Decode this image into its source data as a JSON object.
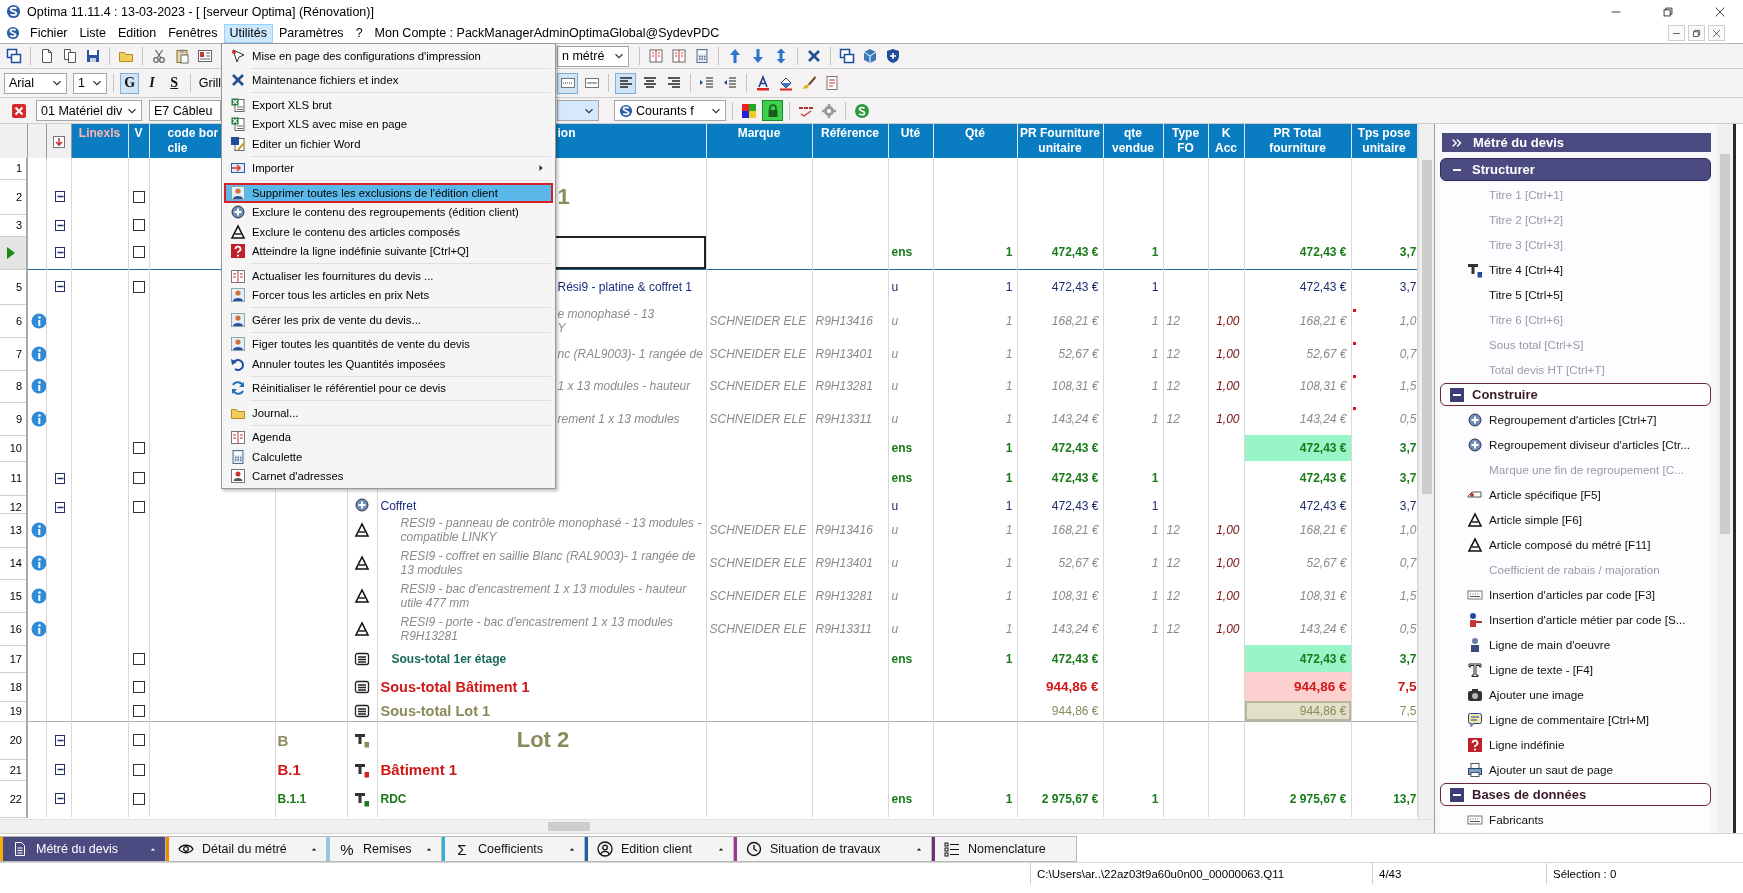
{
  "window": {
    "title": "Optima 11.11.4 : 13-03-2023 - [ [serveur Optima] (Rénovation)]"
  },
  "menu_bar": {
    "items": [
      {
        "label": "Fichier",
        "selected": false
      },
      {
        "label": "Liste",
        "selected": false
      },
      {
        "label": "Edition",
        "selected": false
      },
      {
        "label": "Fenêtres",
        "selected": false
      },
      {
        "label": "Utilités",
        "selected": true
      },
      {
        "label": "Paramètres",
        "selected": false
      },
      {
        "label": "?",
        "selected": false
      }
    ],
    "account": "Mon Compte : PackManagerAdminOptimaGlobal@SydevPDC"
  },
  "toolbar": {
    "view_dropdown": "n métré",
    "font_dropdown": "Arial",
    "size_dropdown": "1",
    "format_buttons": [
      {
        "label": "G",
        "kind": "bold",
        "selected": true
      },
      {
        "label": "I",
        "kind": "italic",
        "selected": false
      },
      {
        "label": "S",
        "kind": "underline",
        "selected": false
      }
    ],
    "grid_label": "Grill",
    "paragraph_buttons": [
      {
        "kind": "border-dotted",
        "selected": true
      },
      {
        "kind": "border-solid",
        "selected": false
      },
      {
        "kind": "align-left",
        "selected": true
      },
      {
        "kind": "align-center",
        "selected": false
      },
      {
        "kind": "align-right",
        "selected": false
      }
    ],
    "family_dropdown": "01 Matériel div",
    "code_dropdown": "E7 Câbleu",
    "filter_dropdown": "Courants f",
    "lock_selected": true
  },
  "utilities_menu": {
    "groups": [
      [
        {
          "label": "Mise en page des configurations d'impression",
          "kind": "pointer",
          "selected": false
        }
      ],
      [
        {
          "label": "Maintenance fichiers et index",
          "kind": "tools",
          "selected": false
        }
      ],
      [
        {
          "label": "Export XLS brut",
          "kind": "sheet",
          "selected": false
        },
        {
          "label": "Export XLS avec mise en page",
          "kind": "sheet",
          "selected": false
        },
        {
          "label": "Editer un fichier Word",
          "kind": "word",
          "selected": false
        }
      ],
      [
        {
          "label": "Importer",
          "kind": "import",
          "selected": false,
          "submenu": true
        }
      ],
      [
        {
          "label": "Supprimer toutes les exclusions de l'édition client",
          "kind": "person",
          "selected": true
        },
        {
          "label": "Exclure le contenu des regroupements (édition client)",
          "kind": "group",
          "selected": false
        },
        {
          "label": "Exclure le contenu des articles composés",
          "kind": "article",
          "selected": false
        },
        {
          "label": "Atteindre la ligne indéfinie suivante [Ctrl+Q]",
          "kind": "help",
          "selected": false
        }
      ],
      [
        {
          "label": "Actualiser les fournitures du devis ...",
          "kind": "calendar",
          "selected": false
        },
        {
          "label": "Forcer tous les articles en prix Nets",
          "kind": "person",
          "selected": false
        }
      ],
      [
        {
          "label": "Gérer les prix de vente du devis...",
          "kind": "person",
          "selected": false
        }
      ],
      [
        {
          "label": "Figer toutes les quantités de vente du devis",
          "kind": "person",
          "selected": false
        },
        {
          "label": "Annuler toutes les Quantités imposées",
          "kind": "undo",
          "selected": false
        }
      ],
      [
        {
          "label": "Réinitialiser le référentiel pour ce devis",
          "kind": "refresh",
          "selected": false
        }
      ],
      [
        {
          "label": "Journal...",
          "kind": "folder",
          "selected": false
        }
      ],
      [
        {
          "label": "Agenda",
          "kind": "calendar",
          "selected": false
        },
        {
          "label": "Calculette",
          "kind": "calc",
          "selected": false
        },
        {
          "label": "Carnet d'adresses",
          "kind": "contact",
          "selected": false
        }
      ]
    ]
  },
  "grid": {
    "columns": [
      "Linexls",
      "V",
      "code bor\nclie",
      "ion",
      "Marque",
      "Référence",
      "Uté",
      "Qté",
      "PR Fourniture\nunitaire",
      "qte\nvendue",
      "Type\nFO",
      "K\nAcc",
      "PR Total\nfourniture",
      "Tps pose\nunitaire"
    ],
    "rows": [
      {
        "num": "1",
        "current": false,
        "kind": "blank"
      },
      {
        "num": "2",
        "current": false,
        "kind": "lot-title",
        "partial": true,
        "expanded": true,
        "checked": false,
        "text": "1"
      },
      {
        "num": "3",
        "current": false,
        "kind": "blank",
        "expanded": true,
        "checked": false
      },
      {
        "current": true,
        "kind": "floor-title",
        "expanded": true,
        "checked": false,
        "editing": true,
        "ute": "ens",
        "qte": "1",
        "pru": "472,43 €",
        "qtev": "1",
        "prt": "472,43 €",
        "tps": "3,7"
      },
      {
        "num": "5",
        "current": false,
        "kind": "group",
        "partial": true,
        "expanded": true,
        "checked": false,
        "text": "Rési9 - platine & coffret 1",
        "ute": "u",
        "qte": "1",
        "pru": "472,43 €",
        "qtev": "1",
        "prt": "472,43 €",
        "tps": "3,7"
      },
      {
        "num": "6",
        "current": false,
        "kind": "article",
        "partial": true,
        "text": "e monophasé - 13\nY",
        "marque": "SCHNEIDER ELE",
        "ref": "R9H13416",
        "ute": "u",
        "qte": "1",
        "pru": "168,21 €",
        "qtev": "1",
        "type": "12",
        "kacc": "1,00",
        "prt": "168,21 €",
        "flag": true,
        "tps": "1,0"
      },
      {
        "num": "7",
        "current": false,
        "kind": "article",
        "partial": true,
        "text": "nc (RAL9003)- 1 rangée de",
        "marque": "SCHNEIDER ELE",
        "ref": "R9H13401",
        "ute": "u",
        "qte": "1",
        "pru": "52,67 €",
        "qtev": "1",
        "type": "12",
        "kacc": "1,00",
        "prt": "52,67 €",
        "flag": true,
        "tps": "0,7"
      },
      {
        "num": "8",
        "current": false,
        "kind": "article",
        "partial": true,
        "text": "1 x 13 modules - hauteur",
        "marque": "SCHNEIDER ELE",
        "ref": "R9H13281",
        "ute": "u",
        "qte": "1",
        "pru": "108,31 €",
        "qtev": "1",
        "type": "12",
        "kacc": "1,00",
        "prt": "108,31 €",
        "flag": true,
        "tps": "1,5"
      },
      {
        "num": "9",
        "current": false,
        "kind": "article",
        "partial": true,
        "text": "rement 1 x 13 modules",
        "marque": "SCHNEIDER ELE",
        "ref": "R9H13311",
        "ute": "u",
        "qte": "1",
        "pru": "143,24 €",
        "qtev": "1",
        "type": "12",
        "kacc": "1,00",
        "prt": "143,24 €",
        "flag": true,
        "tps": "0,5"
      },
      {
        "num": "10",
        "current": false,
        "kind": "subtotal-floor",
        "checked": false,
        "ute": "ens",
        "qte": "1",
        "pru": "472,43 €",
        "prt": "472,43 €",
        "tps": "3,7"
      },
      {
        "num": "11",
        "current": false,
        "kind": "floor-title",
        "expanded": true,
        "checked": false,
        "ute": "ens",
        "qte": "1",
        "pru": "472,43 €",
        "qtev": "1",
        "prt": "472,43 €",
        "tps": "3,7"
      },
      {
        "num": "12",
        "current": false,
        "kind": "group",
        "expanded": true,
        "checked": false,
        "text": "Coffret",
        "ute": "u",
        "qte": "1",
        "pru": "472,43 €",
        "qtev": "1",
        "prt": "472,43 €",
        "tps": "3,7"
      },
      {
        "num": "13",
        "current": false,
        "kind": "article",
        "text": "RESI9 - panneau de contrôle monophasé - 13 modules - compatible LINKY",
        "marque": "SCHNEIDER ELE",
        "ref": "R9H13416",
        "ute": "u",
        "qte": "1",
        "pru": "168,21 €",
        "qtev": "1",
        "type": "12",
        "kacc": "1,00",
        "prt": "168,21 €",
        "flag": false,
        "tps": "1,0"
      },
      {
        "num": "14",
        "current": false,
        "kind": "article",
        "text": "RESI9 - coffret en saillie Blanc (RAL9003)- 1 rangée de 13 modules",
        "marque": "SCHNEIDER ELE",
        "ref": "R9H13401",
        "ute": "u",
        "qte": "1",
        "pru": "52,67 €",
        "qtev": "1",
        "type": "12",
        "kacc": "1,00",
        "prt": "52,67 €",
        "flag": false,
        "tps": "0,7"
      },
      {
        "num": "15",
        "current": false,
        "kind": "article",
        "text": "RESI9 - bac d'encastrement 1 x 13 modules - hauteur utile 477 mm",
        "marque": "SCHNEIDER ELE",
        "ref": "R9H13281",
        "ute": "u",
        "qte": "1",
        "pru": "108,31 €",
        "qtev": "1",
        "type": "12",
        "kacc": "1,00",
        "prt": "108,31 €",
        "flag": false,
        "tps": "1,5"
      },
      {
        "num": "16",
        "current": false,
        "kind": "article",
        "text": "RESI9 - porte - bac d'encastrement 1 x 13 modules R9H13281",
        "marque": "SCHNEIDER ELE",
        "ref": "R9H13311",
        "ute": "u",
        "qte": "1",
        "pru": "143,24 €",
        "qtev": "1",
        "type": "12",
        "kacc": "1,00",
        "prt": "143,24 €",
        "flag": false,
        "tps": "0,5"
      },
      {
        "num": "17",
        "current": false,
        "kind": "subtotal-floor",
        "checked": false,
        "text": "Sous-total 1er étage",
        "ute": "ens",
        "qte": "1",
        "pru": "472,43 €",
        "prt": "472,43 €",
        "tps": "3,7"
      },
      {
        "num": "18",
        "current": false,
        "kind": "subtotal-building",
        "checked": false,
        "text": "Sous-total Bâtiment 1",
        "pru": "944,86 €",
        "prt": "944,86 €",
        "tps": "7,5"
      },
      {
        "num": "19",
        "current": false,
        "kind": "subtotal-lot",
        "checked": false,
        "text": "Sous-total Lot 1",
        "pru": "944,86 €",
        "prt": "944,86 €",
        "tps": "7,5"
      },
      {
        "num": "20",
        "current": false,
        "kind": "lot-title",
        "expanded": true,
        "checked": false,
        "code": "B",
        "text": "Lot 2"
      },
      {
        "num": "21",
        "current": false,
        "kind": "building-title",
        "expanded": true,
        "checked": false,
        "code": "B.1",
        "text": "Bâtiment 1"
      },
      {
        "num": "22",
        "current": false,
        "kind": "floor-title",
        "expanded": true,
        "checked": false,
        "code": "B.1.1",
        "text": "RDC",
        "ute": "ens",
        "qte": "1",
        "pru": "2 975,67 €",
        "qtev": "1",
        "prt": "2 975,67 €",
        "tps": "13,7"
      }
    ]
  },
  "side_panel": {
    "title": "Métré du devis",
    "sections": [
      {
        "label": "Structurer",
        "active": true,
        "expanded": true,
        "items": [
          {
            "label": "Titre 1 [Ctrl+1]",
            "disabled": true
          },
          {
            "label": "Titre 2 [Ctrl+2]",
            "disabled": true
          },
          {
            "label": "Titre 3 [Ctrl+3]",
            "disabled": true
          },
          {
            "label": "Titre 4 [Ctrl+4]",
            "disabled": false,
            "kind": "title4"
          },
          {
            "label": "Titre 5 [Ctrl+5]",
            "disabled": false
          },
          {
            "label": "Titre 6 [Ctrl+6]",
            "disabled": true
          },
          {
            "label": "Sous total [Ctrl+S]",
            "disabled": true
          },
          {
            "label": "Total devis HT [Ctrl+T]",
            "disabled": true
          }
        ]
      },
      {
        "label": "Construire",
        "active": false,
        "expanded": true,
        "items": [
          {
            "label": "Regroupement d'articles [Ctrl+7]",
            "disabled": false,
            "kind": "group"
          },
          {
            "label": "Regroupement diviseur d'articles [Ctr...",
            "disabled": false,
            "kind": "group"
          },
          {
            "label": "Marque une fin de regroupement [C...",
            "disabled": true
          },
          {
            "label": "Article spécifique [F5]",
            "disabled": false,
            "kind": "specific"
          },
          {
            "label": "Article simple [F6]",
            "disabled": false,
            "kind": "article"
          },
          {
            "label": "Article composé du métré [F11]",
            "disabled": false,
            "kind": "article"
          },
          {
            "label": "Coefficient de rabais / majoration",
            "disabled": true
          },
          {
            "label": "Insertion d'articles par code [F3]",
            "disabled": false,
            "kind": "code"
          },
          {
            "label": "Insertion d'article métier par code [S...",
            "disabled": false,
            "kind": "trade"
          },
          {
            "label": "Ligne de main d'oeuvre",
            "disabled": false,
            "kind": "worker"
          },
          {
            "label": "Ligne de texte - [F4]",
            "disabled": false,
            "kind": "text"
          },
          {
            "label": "Ajouter une image",
            "disabled": false,
            "kind": "camera"
          },
          {
            "label": "Ligne de commentaire [Ctrl+M]",
            "disabled": false,
            "kind": "comment"
          },
          {
            "label": "Ligne indéfinie",
            "disabled": false,
            "kind": "help"
          },
          {
            "label": "Ajouter un saut de page",
            "disabled": false,
            "kind": "pagebreak"
          }
        ]
      },
      {
        "label": "Bases de données",
        "active": false,
        "expanded": true,
        "items": [
          {
            "label": "Fabricants",
            "disabled": false,
            "kind": "code"
          }
        ]
      }
    ]
  },
  "bottom_tabs": [
    {
      "label": "Métré du devis",
      "selected": true,
      "color": "#f0b400",
      "kind": "document",
      "caret": true
    },
    {
      "label": "Détail du métré",
      "selected": false,
      "color": "#f08a00",
      "kind": "eye",
      "caret": true
    },
    {
      "label": "Remises",
      "selected": false,
      "color": "#8ccbec",
      "glyph": "%",
      "caret": true
    },
    {
      "label": "Coefficients",
      "selected": false,
      "color": "#2fb0d8",
      "glyph": "Σ",
      "caret": true
    },
    {
      "label": "Edition client",
      "selected": false,
      "color": "#1f5fae",
      "kind": "user",
      "caret": true
    },
    {
      "label": "Situation de travaux",
      "selected": false,
      "color": "#9b3a8f",
      "kind": "clock",
      "caret": true
    },
    {
      "label": "Nomenclature",
      "selected": false,
      "color": "#6e2f7a",
      "kind": "list",
      "caret": false
    }
  ],
  "status_bar": {
    "path": "C:\\Users\\ar..\\22az03t9a60u0n00_00000063.Q11",
    "position": "4/43",
    "selection": "Sélection : 0"
  }
}
